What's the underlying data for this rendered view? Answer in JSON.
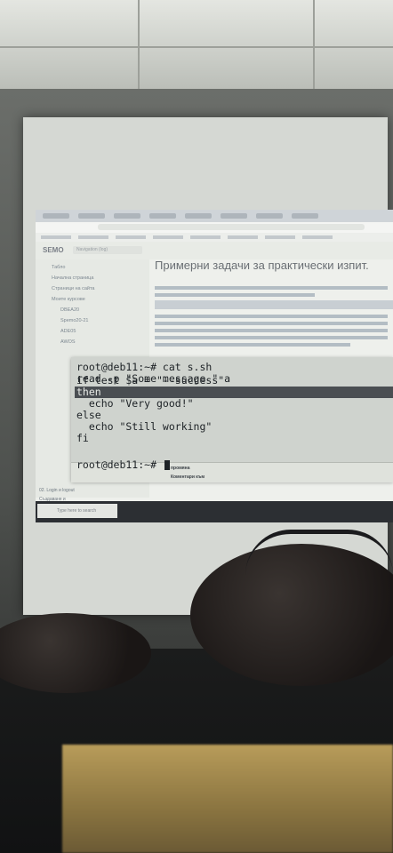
{
  "browser": {
    "site_logo": "SEMO",
    "search_placeholder": "Navigation (log)",
    "page_heading": "Примерни задачи за практически изпит."
  },
  "sidebar": {
    "items": [
      "Табло",
      "Начална страница",
      "Страници на сайта",
      "Моите курсове",
      "DBEA20",
      "Spemo20-21",
      "ADE05",
      "AWOS"
    ],
    "lower_items": [
      "02. Login и logout",
      "Създаване и"
    ]
  },
  "terminal": {
    "lines": [
      "root@deb11:~# cat s.sh",
      "read -p \"Some message \" a",
      "if test $a = \"--success\"",
      "then",
      "  echo \"Very good!\"",
      "else",
      "  echo \"Still working\"",
      "fi",
      "",
      "root@deb11:~# "
    ],
    "highlighted_line_index": 3,
    "footer_labels": [
      "промяна",
      "Коментари към"
    ]
  },
  "taskbar": {
    "search_placeholder": "Type here to search"
  },
  "colors": {
    "terminal_bg": "#cfd3ce",
    "terminal_text": "#1d2226",
    "highlight_bg": "#4a4e52"
  }
}
